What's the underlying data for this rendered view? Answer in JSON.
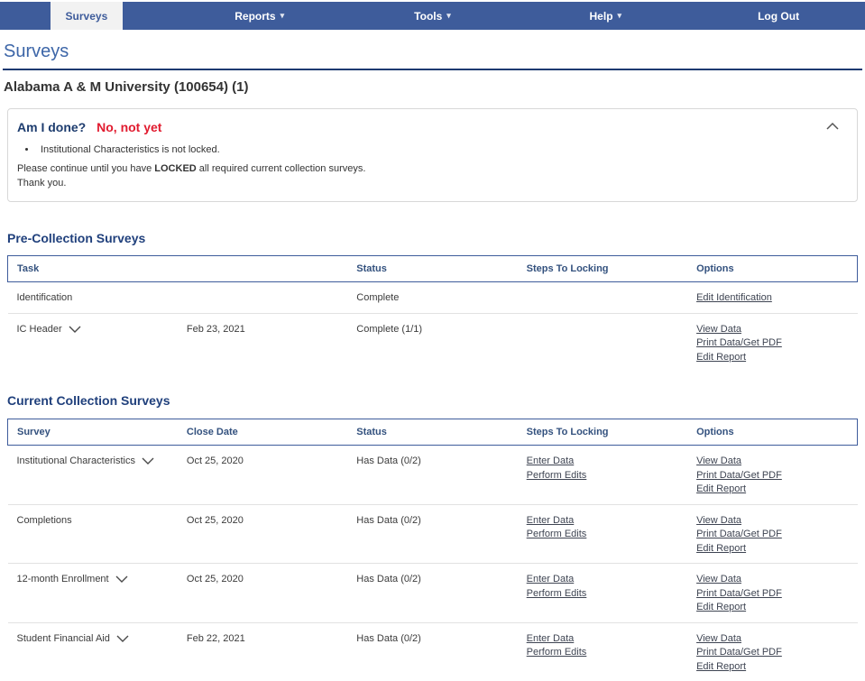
{
  "colors": {
    "nav_blue": "#3e5c9b",
    "title_blue": "#3d66a8",
    "heading_navy": "#20407c",
    "rule_navy": "#1d3a71",
    "alert_red": "#e11b2f",
    "link_gray": "#3e4452",
    "active_tab_bg": "#f2f2f2"
  },
  "nav": {
    "caret_glyph": "▾",
    "items": [
      {
        "label": "Surveys"
      },
      {
        "label": "Reports"
      },
      {
        "label": "Tools"
      },
      {
        "label": "Help"
      },
      {
        "label": "Log Out"
      }
    ]
  },
  "page": {
    "title": "Surveys",
    "institution": "Alabama A & M University (100654) (1)"
  },
  "alert": {
    "question": "Am I done?",
    "answer": "No, not yet",
    "bullets": [
      "Institutional Characteristics is not locked."
    ],
    "line1_pre": "Please continue until you have ",
    "line1_bold": "LOCKED",
    "line1_post": " all required current collection surveys.",
    "line2": "Thank you."
  },
  "pre_collection": {
    "heading": "Pre-Collection Surveys",
    "columns": {
      "task": "Task",
      "date": "",
      "status": "Status",
      "steps": "Steps To Locking",
      "options": "Options"
    },
    "rows": [
      {
        "task": "Identification",
        "date": "",
        "status": "Complete",
        "options": [
          "Edit Identification"
        ]
      },
      {
        "task": "IC Header",
        "date": "Feb 23, 2021",
        "status": "Complete (1/1)",
        "options": [
          "View Data",
          "Print Data/Get PDF",
          "Edit Report"
        ]
      }
    ]
  },
  "current_collection": {
    "heading": "Current Collection Surveys",
    "columns": {
      "survey": "Survey",
      "date": "Close Date",
      "status": "Status",
      "steps": "Steps To Locking",
      "options": "Options"
    },
    "rows": [
      {
        "survey": "Institutional Characteristics",
        "date": "Oct 25, 2020",
        "status": "Has Data (0/2)",
        "steps": [
          "Enter Data",
          "Perform Edits"
        ],
        "options": [
          "View Data",
          "Print Data/Get PDF",
          "Edit Report"
        ]
      },
      {
        "survey": "Completions",
        "date": "Oct 25, 2020",
        "status": "Has Data (0/2)",
        "steps": [
          "Enter Data",
          "Perform Edits"
        ],
        "options": [
          "View Data",
          "Print Data/Get PDF",
          "Edit Report"
        ]
      },
      {
        "survey": "12-month Enrollment",
        "date": "Oct 25, 2020",
        "status": "Has Data (0/2)",
        "steps": [
          "Enter Data",
          "Perform Edits"
        ],
        "options": [
          "View Data",
          "Print Data/Get PDF",
          "Edit Report"
        ]
      },
      {
        "survey": "Student Financial Aid",
        "date": "Feb 22, 2021",
        "status": "Has Data (0/2)",
        "steps": [
          "Enter Data",
          "Perform Edits"
        ],
        "options": [
          "View Data",
          "Print Data/Get PDF",
          "Edit Report"
        ]
      }
    ]
  }
}
